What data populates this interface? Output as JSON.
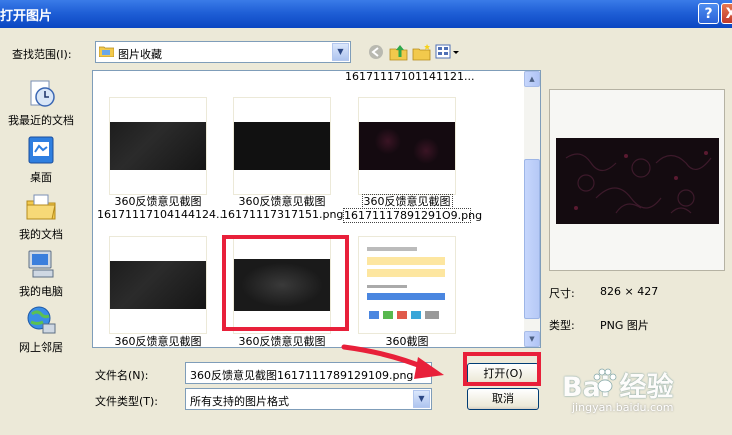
{
  "title_bar": {
    "title": "打开图片",
    "help": "?",
    "close": "X"
  },
  "look_in": {
    "label": "查找范围(I):",
    "value": "图片收藏"
  },
  "places": [
    {
      "label": "我最近的文档",
      "icon": "recent-documents-icon"
    },
    {
      "label": "桌面",
      "icon": "desktop-icon"
    },
    {
      "label": "我的文档",
      "icon": "my-documents-icon"
    },
    {
      "label": "我的电脑",
      "icon": "my-computer-icon"
    },
    {
      "label": "网上邻居",
      "icon": "network-places-icon"
    }
  ],
  "files": {
    "top_partial": "16171117101141121...",
    "row1": [
      {
        "l1": "360反馈意见截图",
        "l2": "16171117104144124..."
      },
      {
        "l1": "360反馈意见截图",
        "l2": "16171117317151.png"
      },
      {
        "l1": "360反馈意见截图",
        "l2": "16171117891291O9.png"
      }
    ],
    "row2": [
      {
        "l1": "360反馈意见截图"
      },
      {
        "l1": "360反馈意见截图"
      },
      {
        "l1": "360截图"
      }
    ]
  },
  "preview": {
    "size_label": "尺寸:",
    "size_value": "826 × 427",
    "type_label": "类型:",
    "type_value": "PNG 图片"
  },
  "filename": {
    "label": "文件名(N):",
    "value": "360反馈意见截图1617111789129109.png"
  },
  "filetype": {
    "label": "文件类型(T):",
    "value": "所有支持的图片格式"
  },
  "buttons": {
    "open": "打开(O)",
    "cancel": "取消"
  },
  "watermark": {
    "brand": "Bai  经验",
    "url": "jingyan.baidu.com"
  },
  "colors": {
    "title_bar": "#1f5fd6",
    "annotation": "#e8203a",
    "dialog_bg": "#ece9d8"
  }
}
